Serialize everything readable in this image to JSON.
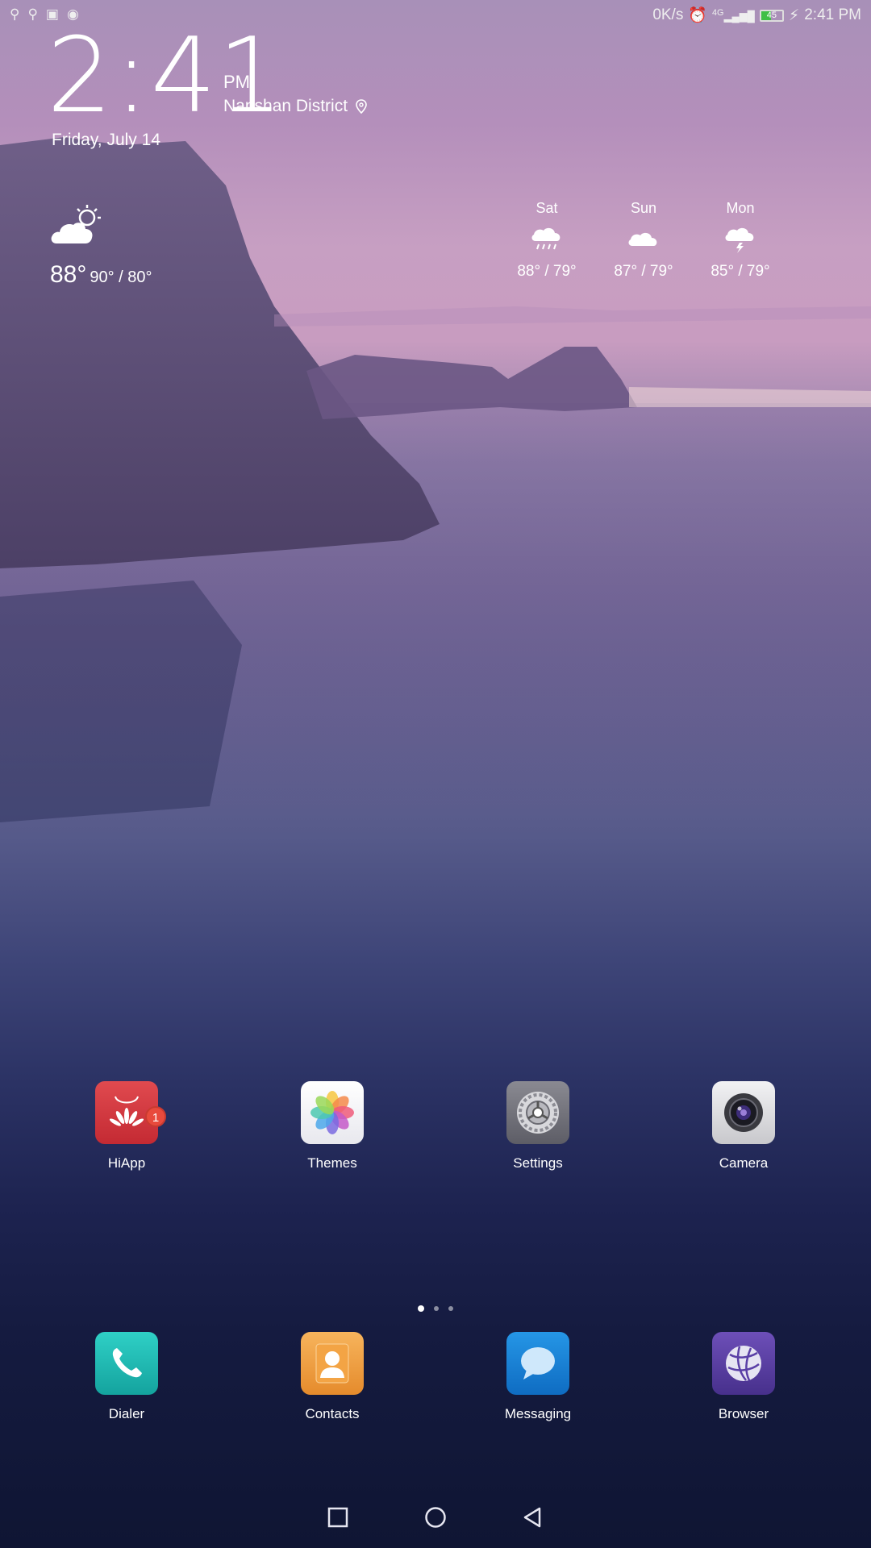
{
  "status_bar": {
    "net_speed": "0K/s",
    "network": "4G",
    "battery_level": "45",
    "time": "2:41 PM",
    "left_icons": [
      "usb-icon",
      "usb-icon",
      "image-icon",
      "vpn-icon"
    ]
  },
  "clock_widget": {
    "time": "2:41",
    "ampm": "PM",
    "location": "Nanshan District",
    "date": "Friday, July 14"
  },
  "weather_widget": {
    "current_temp": "88°",
    "range": "90° / 80°",
    "forecast": [
      {
        "day": "Sat",
        "range": "88° / 79°",
        "icon": "rain-cloud-icon"
      },
      {
        "day": "Sun",
        "range": "87° / 79°",
        "icon": "cloud-icon"
      },
      {
        "day": "Mon",
        "range": "85° / 79°",
        "icon": "thunderstorm-icon"
      }
    ]
  },
  "apps": [
    {
      "label": "HiApp",
      "badge": "1"
    },
    {
      "label": "Themes"
    },
    {
      "label": "Settings"
    },
    {
      "label": "Camera"
    }
  ],
  "dock": [
    {
      "label": "Dialer"
    },
    {
      "label": "Contacts"
    },
    {
      "label": "Messaging"
    },
    {
      "label": "Browser"
    }
  ],
  "colors": {
    "hiapp": "#d8363d",
    "dialer": "#1fb8b2",
    "contacts": "#f09a3a",
    "messaging": "#1a7fd4",
    "browser": "#5b3fa0",
    "badge": "#e84a3c"
  }
}
